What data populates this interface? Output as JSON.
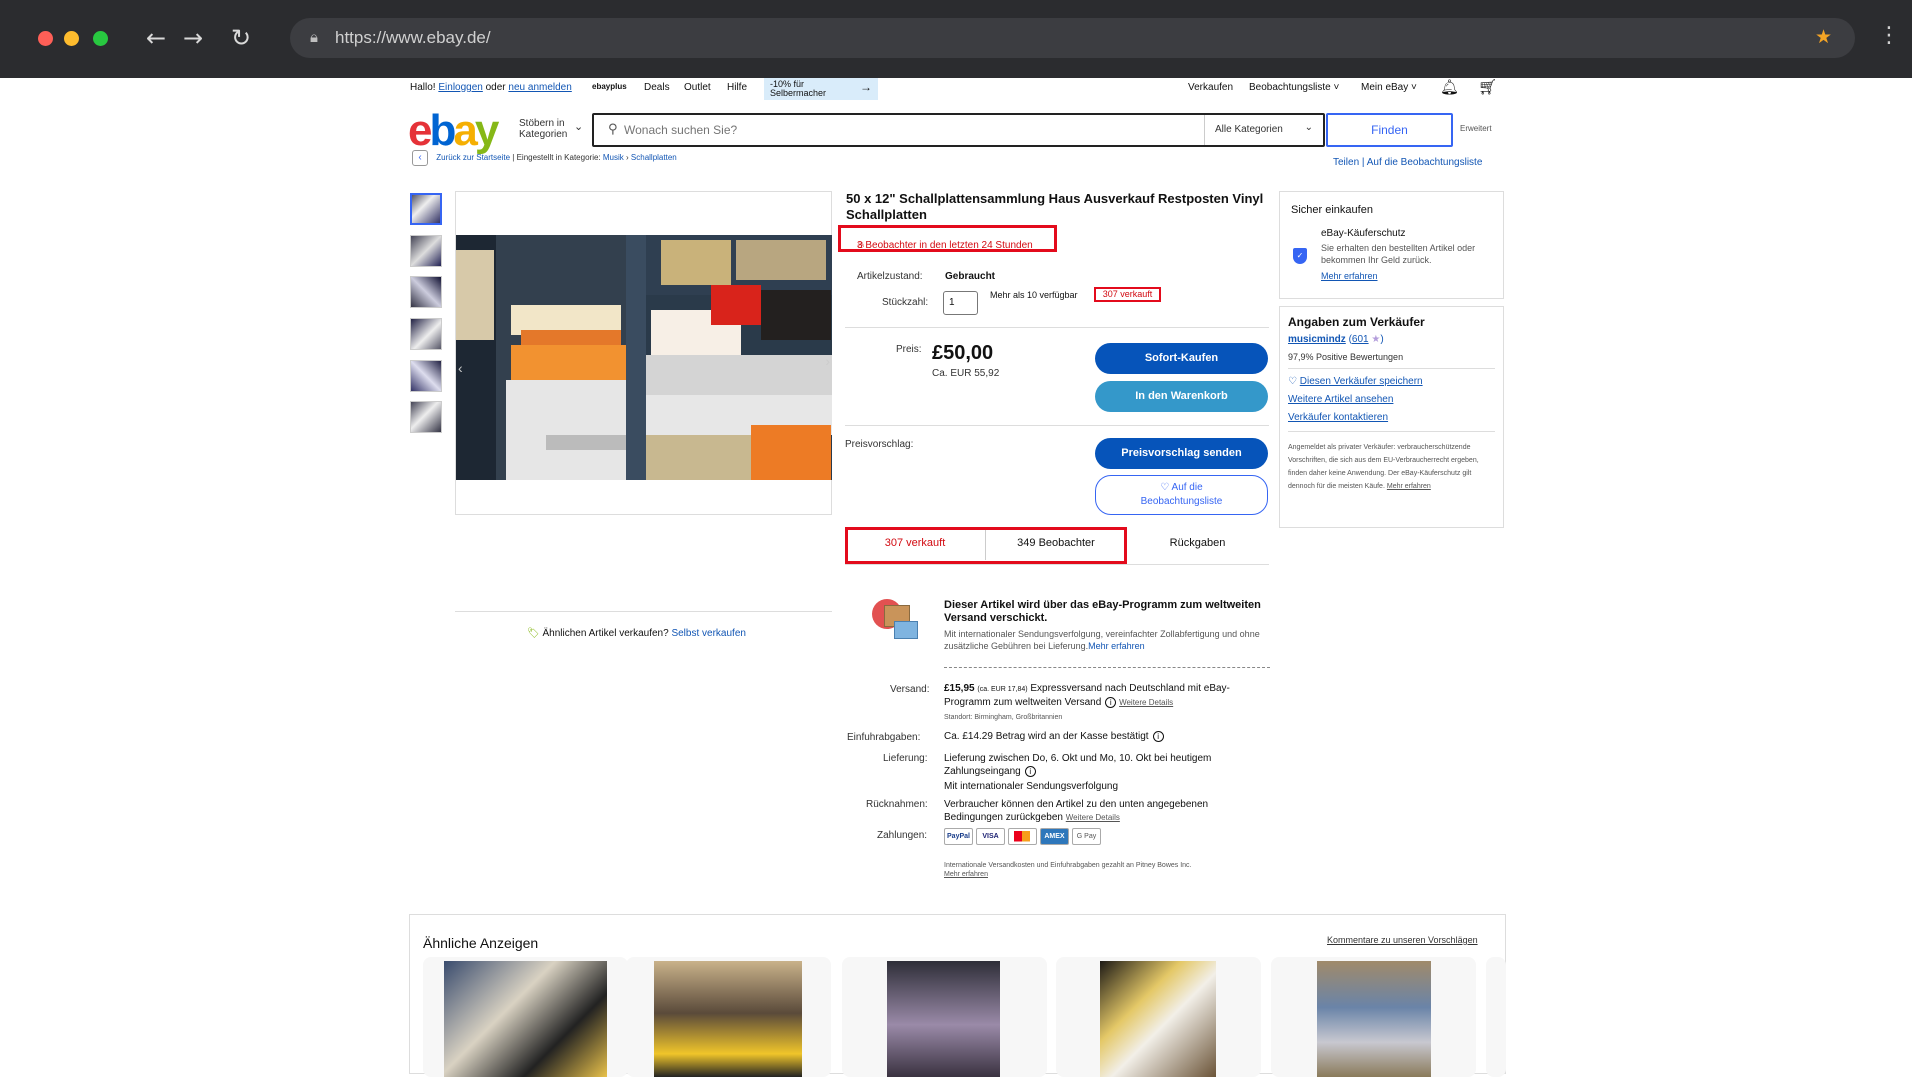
{
  "browser": {
    "url": "https://www.ebay.de/"
  },
  "topnav": {
    "greeting": "Hallo!",
    "login": "Einloggen",
    "or": "oder",
    "register": "neu anmelden",
    "ebayplus": "ebayplus",
    "deals": "Deals",
    "outlet": "Outlet",
    "help": "Hilfe",
    "promo_line1": "-10% für",
    "promo_line2": "Selbermacher",
    "sell": "Verkaufen",
    "watchlist": "Beobachtungsliste",
    "myebay": "Mein eBay"
  },
  "header": {
    "browse_line1": "Stöbern in",
    "browse_line2": "Kategorien",
    "search_placeholder": "Wonach suchen Sie?",
    "category": "Alle Kategorien",
    "search_button": "Finden",
    "advanced": "Erweitert"
  },
  "breadcrumb": {
    "back": "Zurück zur Startseite",
    "listed_in": "Eingestellt in Kategorie:",
    "cat1": "Musik",
    "cat2": "Schallplatten",
    "share": "Teilen",
    "add_watch": "Auf die Beobachtungsliste"
  },
  "listing": {
    "title": "50 x 12\" Schallplattensammlung Haus Ausverkauf Restposten Vinyl Schallplatten",
    "watchers_24h": "3 Beobachter in den letzten 24 Stunden",
    "condition_label": "Artikelzustand:",
    "condition_value": "Gebraucht",
    "qty_label": "Stückzahl:",
    "qty_value": "1",
    "availability": "Mehr als 10 verfügbar",
    "sold_small": "307 verkauft",
    "price_label": "Preis:",
    "price": "£50,00",
    "price_eur": "Ca. EUR 55,92",
    "buy_now": "Sofort-Kaufen",
    "add_to_cart": "In den Warenkorb",
    "offer_label": "Preisvorschlag:",
    "send_offer": "Preisvorschlag senden",
    "watch_line1": "♡ Auf die",
    "watch_line2": "Beobachtungsliste",
    "sell_similar_q": "Ähnlichen Artikel verkaufen?",
    "sell_similar_link": "Selbst verkaufen"
  },
  "tabs": {
    "sold": "307 verkauft",
    "watchers": "349 Beobachter",
    "returns": "Rückgaben"
  },
  "gsp": {
    "title": "Dieser Artikel wird über das eBay-Programm zum weltweiten Versand verschickt.",
    "desc": "Mit internationaler Sendungsverfolgung, vereinfachter Zollabfertigung und ohne zusätzliche Gebühren bei Lieferung.",
    "more": "Mehr erfahren"
  },
  "details": {
    "shipping_label": "Versand:",
    "shipping_price": "£15,95",
    "shipping_eur": "(ca. EUR 17,84)",
    "shipping_desc": "Expressversand nach Deutschland mit eBay-Programm zum weltweiten Versand",
    "shipping_more": "Weitere Details",
    "location": "Standort: Birmingham, Großbritannien",
    "import_label": "Einfuhrabgaben:",
    "import_value": "Ca. £14.29 Betrag wird an der Kasse bestätigt",
    "delivery_label": "Lieferung:",
    "delivery_value": "Lieferung zwischen Do, 6. Okt und Mo, 10. Okt bei heutigem Zahlungseingang",
    "delivery_tracking": "Mit internationaler Sendungsverfolgung",
    "returns_label": "Rücknahmen:",
    "returns_value": "Verbraucher können den Artikel zu den unten angegebenen Bedingungen zurückgeben",
    "returns_more": "Weitere Details",
    "payment_label": "Zahlungen:",
    "payment_methods": [
      "PayPal",
      "VISA",
      "MC",
      "AMEX",
      "G Pay"
    ],
    "footnote": "Internationale Versandkosten und Einfuhrabgaben gezahlt an Pitney Bowes Inc.",
    "footnote_more": "Mehr erfahren"
  },
  "secure": {
    "title": "Sicher einkaufen",
    "program": "eBay-Käuferschutz",
    "desc": "Sie erhalten den bestellten Artikel oder bekommen Ihr Geld zurück.",
    "more": "Mehr erfahren"
  },
  "seller": {
    "heading": "Angaben zum Verkäufer",
    "name": "musicmindz",
    "score": "601",
    "feedback": "97,9% Positive Bewertungen",
    "save": "Diesen Verkäufer speichern",
    "other_items": "Weitere Artikel ansehen",
    "contact": "Verkäufer kontaktieren",
    "private_note": "Angemeldet als privater Verkäufer: verbraucherschützende Vorschriften, die sich aus dem EU-Verbraucherrecht ergeben, finden daher keine Anwendung. Der eBay-Käuferschutz gilt dennoch für die meisten Käufe.",
    "private_more": "Mehr erfahren"
  },
  "similar": {
    "heading": "Ähnliche Anzeigen",
    "feedback_link": "Kommentare zu unseren Vorschlägen"
  },
  "colors": {
    "ebay_blue": "#0654ba",
    "highlight_red": "#e30b1c",
    "link": "#1256b4"
  }
}
